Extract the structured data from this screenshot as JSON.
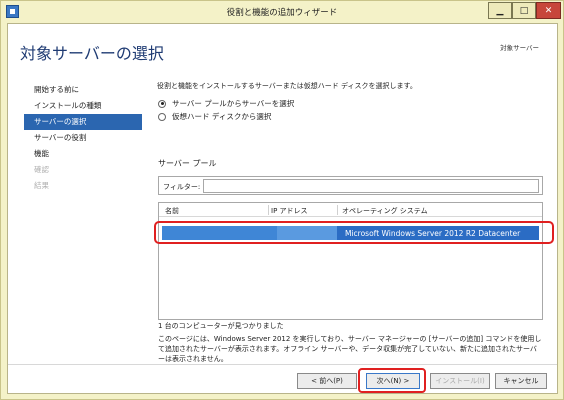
{
  "window": {
    "title": "役割と機能の追加ウィザード"
  },
  "heading": "対象サーバーの選択",
  "destination_label": "対象サーバー",
  "nav": {
    "items": [
      {
        "label": "開始する前に",
        "state": "normal"
      },
      {
        "label": "インストールの種類",
        "state": "normal"
      },
      {
        "label": "サーバーの選択",
        "state": "active"
      },
      {
        "label": "サーバーの役割",
        "state": "normal"
      },
      {
        "label": "機能",
        "state": "normal"
      },
      {
        "label": "確認",
        "state": "disabled"
      },
      {
        "label": "結果",
        "state": "disabled"
      }
    ]
  },
  "content": {
    "instruction": "役割と機能をインストールするサーバーまたは仮想ハード ディスクを選択します。",
    "radio_pool": "サーバー プールからサーバーを選択",
    "radio_vhd": "仮想ハード ディスクから選択",
    "pool_label": "サーバー プール",
    "filter_label": "フィルター:",
    "filter_value": "",
    "columns": {
      "name": "名前",
      "ip": "IP アドレス",
      "os": "オペレーティング システム"
    },
    "selected_row": {
      "name": "",
      "ip": "",
      "os": "Microsoft Windows Server 2012 R2 Datacenter"
    },
    "found_text": "1 台のコンピューターが見つかりました",
    "description": "このページには、Windows Server 2012 を実行しており、サーバー マネージャーの [サーバーの追加] コマンドを使用して追加されたサーバーが表示されます。オフライン サーバーや、データ収集が完了していない、新たに追加されたサーバーは表示されません。"
  },
  "buttons": {
    "back": "< 前へ(P)",
    "next": "次へ(N) >",
    "install": "インストール(I)",
    "cancel": "キャンセル"
  },
  "colors": {
    "accent": "#2b66b0",
    "title_bg": "#f4f2c8",
    "highlight": "#e02020"
  }
}
